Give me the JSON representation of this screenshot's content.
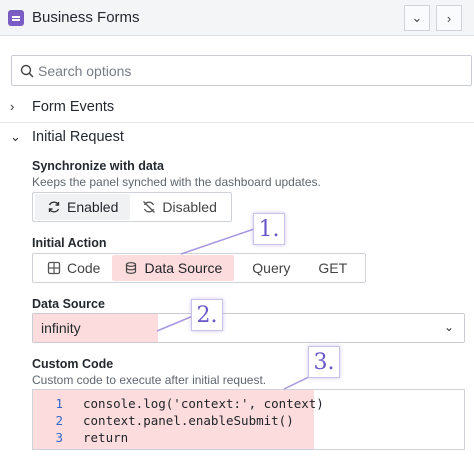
{
  "header": {
    "title": "Business Forms",
    "icon": "form-icon",
    "accent": "#7b5cc4"
  },
  "search": {
    "placeholder": "Search options"
  },
  "sections": {
    "form_events": {
      "label": "Form Events",
      "expanded": false
    },
    "initial_request": {
      "label": "Initial Request",
      "expanded": true
    }
  },
  "synchronize": {
    "label": "Synchronize with data",
    "description": "Keeps the panel synched with the dashboard updates.",
    "options": [
      {
        "label": "Enabled",
        "icon": "sync-icon",
        "selected": true
      },
      {
        "label": "Disabled",
        "icon": "sync-off-icon",
        "selected": false
      }
    ]
  },
  "initial_action": {
    "label": "Initial Action",
    "options": [
      {
        "label": "Code",
        "icon": "code-grid-icon",
        "selected": false
      },
      {
        "label": "Data Source",
        "icon": "database-icon",
        "selected": true
      },
      {
        "label": "Query",
        "selected": false
      },
      {
        "label": "GET",
        "selected": false
      }
    ]
  },
  "data_source": {
    "label": "Data Source",
    "value": "infinity"
  },
  "custom_code": {
    "label": "Custom Code",
    "description": "Custom code to execute after initial request.",
    "lines": [
      {
        "num": "1",
        "text": "console.log('context:', context)"
      },
      {
        "num": "2",
        "text": "context.panel.enableSubmit()"
      },
      {
        "num": "3",
        "text": "return"
      }
    ]
  },
  "callouts": [
    "1.",
    "2.",
    "3."
  ],
  "highlight_color": "#fcdcdc",
  "callout_color": "#6a55c9"
}
